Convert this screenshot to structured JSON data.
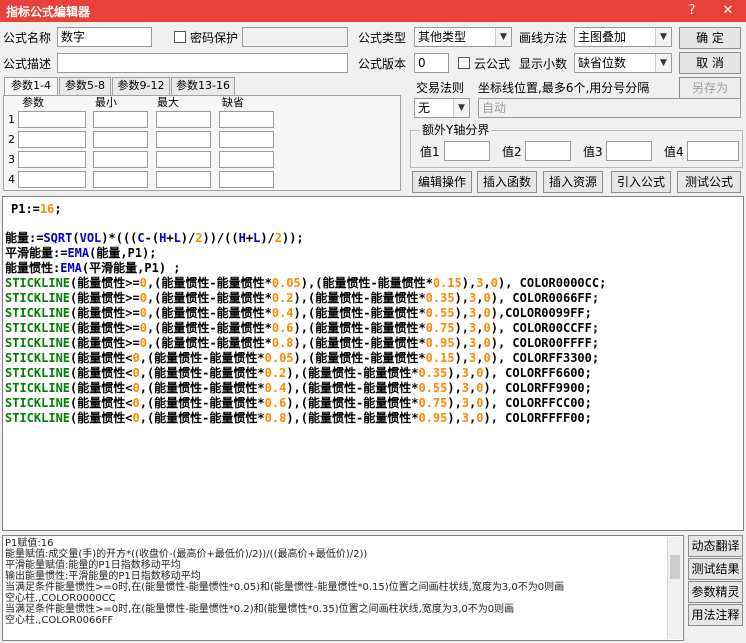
{
  "window": {
    "title": "指标公式编辑器",
    "help": "?",
    "close": "✕"
  },
  "form": {
    "name_label": "公式名称",
    "name_value": "数字",
    "password_label": "密码保护",
    "desc_label": "公式描述",
    "type_label": "公式类型",
    "type_value": "其他类型",
    "draw_label": "画线方法",
    "draw_value": "主图叠加",
    "version_label": "公式版本",
    "version_value": "0",
    "cloud_label": "云公式",
    "decimals_label": "显示小数",
    "decimals_value": "缺省位数",
    "trade_label": "交易法则",
    "trade_value": "无",
    "coord_label": "坐标线位置,最多6个,用分号分隔",
    "coord_value": "自动",
    "extra_axis_label": "额外Y轴分界",
    "v1": "值1",
    "v2": "值2",
    "v3": "值3",
    "v4": "值4"
  },
  "buttons": {
    "ok": "确  定",
    "cancel": "取  消",
    "saveas": "另存为",
    "edit": "编辑操作",
    "insert_func": "插入函数",
    "insert_res": "插入资源",
    "import": "引入公式",
    "test": "测试公式",
    "translate": "动态翻译",
    "test_result": "测试结果",
    "param_tune": "参数精灵",
    "usage": "用法注释"
  },
  "tabs": [
    "参数1-4",
    "参数5-8",
    "参数9-12",
    "参数13-16"
  ],
  "params": {
    "headers": [
      "参数",
      "最小",
      "最大",
      "缺省"
    ],
    "rows": [
      "1",
      "2",
      "3",
      "4"
    ]
  },
  "output": [
    "P1赋值:16",
    "能量赋值:成交量(手)的开方*((收盘价-(最高价+最低价)/2))/((最高价+最低价)/2))",
    "平滑能量赋值:能量的P1日指数移动平均",
    "输出能量惯性:平滑能量的P1日指数移动平均",
    "当满足条件能量惯性>=0时,在(能量惯性-能量惯性*0.05)和(能量惯性-能量惯性*0.15)位置之间画柱状线,宽度为3,0不为0则画",
    "空心柱.,COLOR0000CC",
    "当满足条件能量惯性>=0时,在(能量惯性-能量惯性*0.2)和(能量惯性*0.35)位置之间画柱状线,宽度为3,0不为0则画",
    "空心柱.,COLOR0066FF"
  ]
}
